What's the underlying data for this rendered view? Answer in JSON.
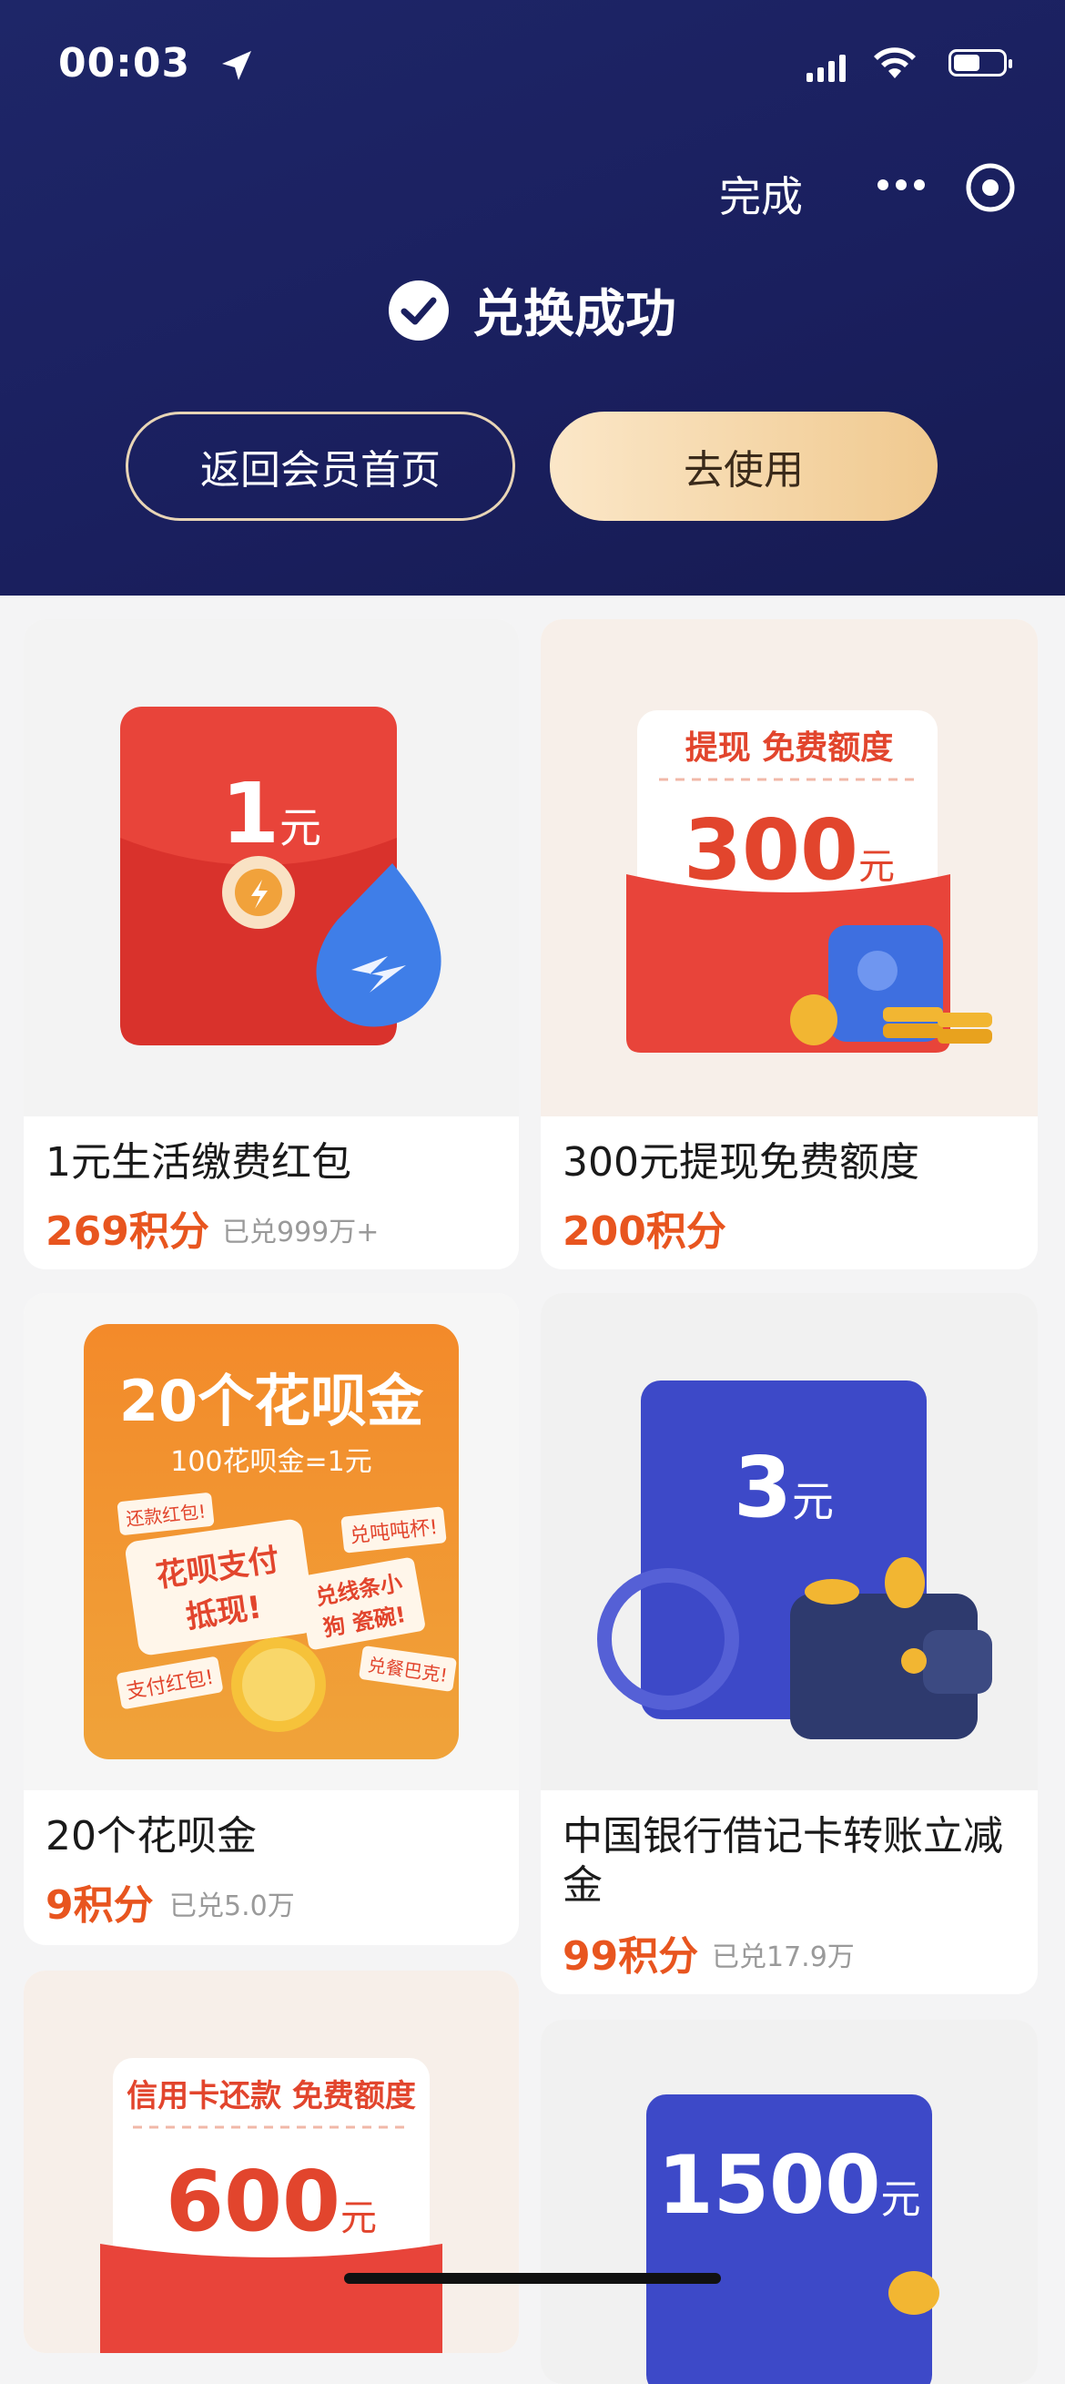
{
  "status": {
    "time": "00:03"
  },
  "nav": {
    "done": "完成"
  },
  "result": {
    "title": "兑换成功"
  },
  "buttons": {
    "back": "返回会员首页",
    "use": "去使用"
  },
  "cards": [
    {
      "title": "1元生活缴费红包",
      "points": "269积分",
      "sold": "已兑999万+",
      "img_amount": "1",
      "img_unit": "元"
    },
    {
      "title": "300元提现免费额度",
      "points": "200积分",
      "sold": "",
      "img_label": "提现 免费额度",
      "img_amount": "300",
      "img_unit": "元"
    },
    {
      "title": "20个花呗金",
      "points": "9积分",
      "sold": "已兑5.0万",
      "img_title": "20个花呗金",
      "img_sub": "100花呗金=1元",
      "img_bubble": "花呗支付 抵现!",
      "img_tags": [
        "还款红包!",
        "兑吨吨杯!",
        "兑线条小狗 瓷碗!",
        "支付红包!",
        "兑餐巴克!"
      ]
    },
    {
      "title": "中国银行借记卡转账立减金",
      "points": "99积分",
      "sold": "已兑17.9万",
      "img_amount": "3",
      "img_unit": "元"
    },
    {
      "title": "",
      "points": "",
      "sold": "",
      "img_label": "信用卡还款 免费额度",
      "img_amount": "600",
      "img_unit": "元"
    },
    {
      "title": "",
      "points": "",
      "sold": "",
      "img_amount": "1500",
      "img_unit": "元"
    }
  ],
  "colors": {
    "header": "#1a1f5e",
    "accent": "#e8551f",
    "gold": "#f0c98f"
  }
}
